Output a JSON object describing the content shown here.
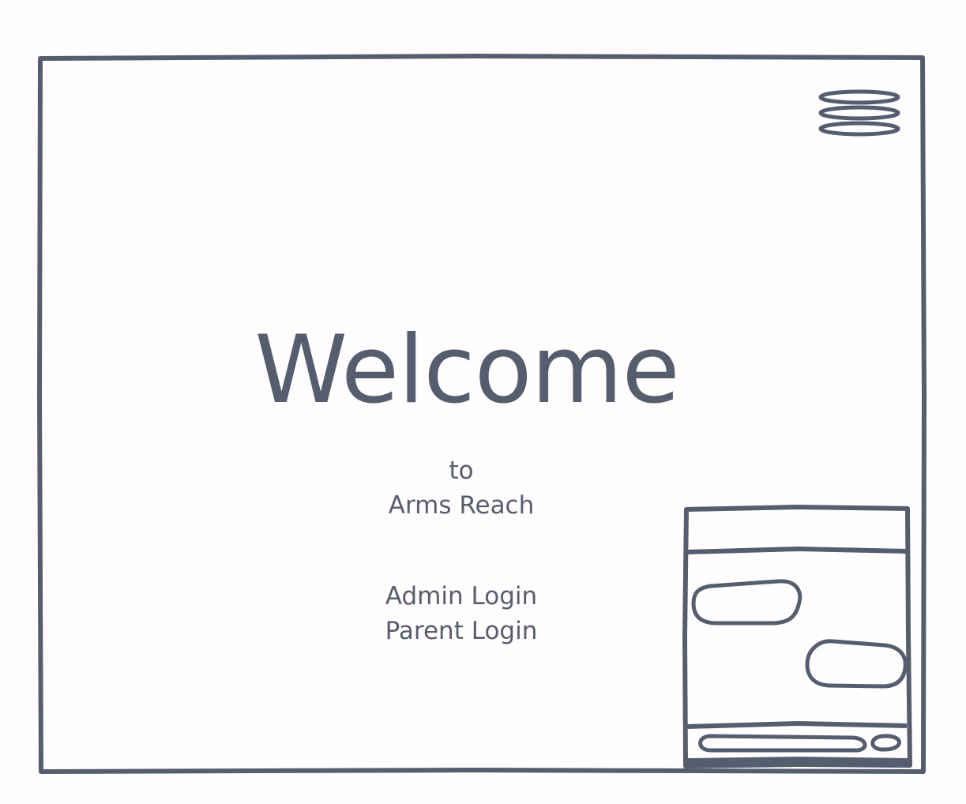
{
  "welcome": {
    "title": "Welcome",
    "to": "to",
    "app_name": "Arms Reach"
  },
  "links": {
    "admin_login": "Admin Login",
    "parent_login": "Parent Login"
  },
  "icons": {
    "menu": "hamburger-menu-icon",
    "chat": "chat-widget-icon"
  },
  "colors": {
    "stroke": "#565d6e",
    "background": "#fffdfd"
  }
}
